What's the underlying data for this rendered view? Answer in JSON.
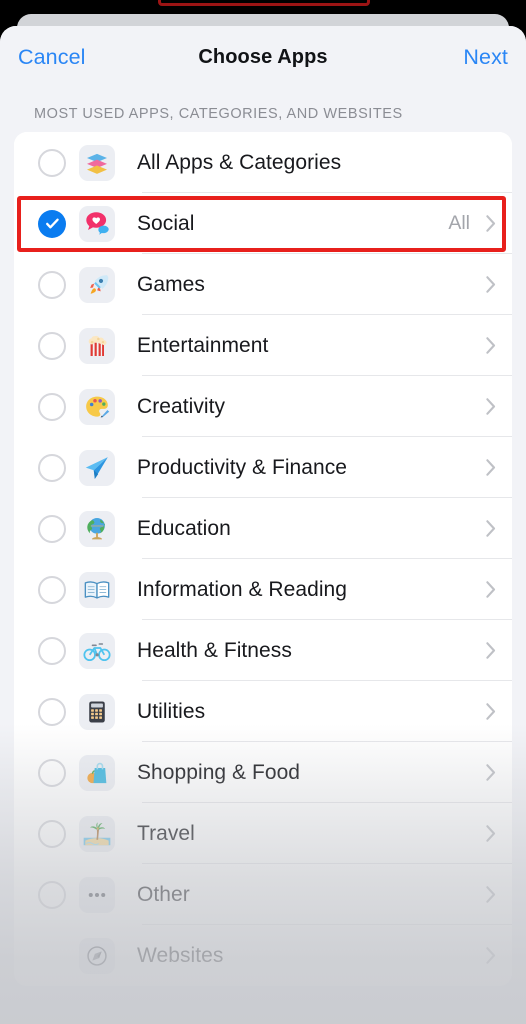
{
  "navbar": {
    "cancel_label": "Cancel",
    "title": "Choose Apps",
    "next_label": "Next"
  },
  "section": {
    "header": "MOST USED APPS, CATEGORIES, AND WEBSITES"
  },
  "colors": {
    "accent_blue": "#2a86f5",
    "checkbox_blue": "#0a7cf0",
    "annotation_red": "#e8201c",
    "sheet_background": "#f2f3f7",
    "card_background": "#ffffff",
    "label_text": "#18191d",
    "secondary_text": "#a3a5ab"
  },
  "annotation": {
    "highlighted_row": "Social",
    "shape": "red-rectangle"
  },
  "list": {
    "rows": [
      {
        "label": "All Apps & Categories",
        "icon": "layers-stack-icon",
        "checkbox": "unchecked",
        "detail": "",
        "chevron": false
      },
      {
        "label": "Social",
        "icon": "speech-bubble-heart-icon",
        "checkbox": "checked",
        "detail": "All",
        "chevron": true
      },
      {
        "label": "Games",
        "icon": "rocket-icon",
        "checkbox": "unchecked",
        "detail": "",
        "chevron": true
      },
      {
        "label": "Entertainment",
        "icon": "popcorn-icon",
        "checkbox": "unchecked",
        "detail": "",
        "chevron": true
      },
      {
        "label": "Creativity",
        "icon": "paint-palette-icon",
        "checkbox": "unchecked",
        "detail": "",
        "chevron": true
      },
      {
        "label": "Productivity & Finance",
        "icon": "paper-plane-icon",
        "checkbox": "unchecked",
        "detail": "",
        "chevron": true
      },
      {
        "label": "Education",
        "icon": "globe-icon",
        "checkbox": "unchecked",
        "detail": "",
        "chevron": true
      },
      {
        "label": "Information & Reading",
        "icon": "open-book-icon",
        "checkbox": "unchecked",
        "detail": "",
        "chevron": true
      },
      {
        "label": "Health & Fitness",
        "icon": "bicycle-icon",
        "checkbox": "unchecked",
        "detail": "",
        "chevron": true
      },
      {
        "label": "Utilities",
        "icon": "calculator-icon",
        "checkbox": "unchecked",
        "detail": "",
        "chevron": true
      },
      {
        "label": "Shopping & Food",
        "icon": "shopping-bag-icon",
        "checkbox": "unchecked",
        "detail": "",
        "chevron": true
      },
      {
        "label": "Travel",
        "icon": "island-palm-icon",
        "checkbox": "unchecked",
        "detail": "",
        "chevron": true
      },
      {
        "label": "Other",
        "icon": "ellipsis-dots-icon",
        "checkbox": "unchecked",
        "detail": "",
        "chevron": true
      },
      {
        "label": "Websites",
        "icon": "compass-safari-icon",
        "checkbox": "none",
        "detail": "",
        "chevron": true
      }
    ]
  }
}
